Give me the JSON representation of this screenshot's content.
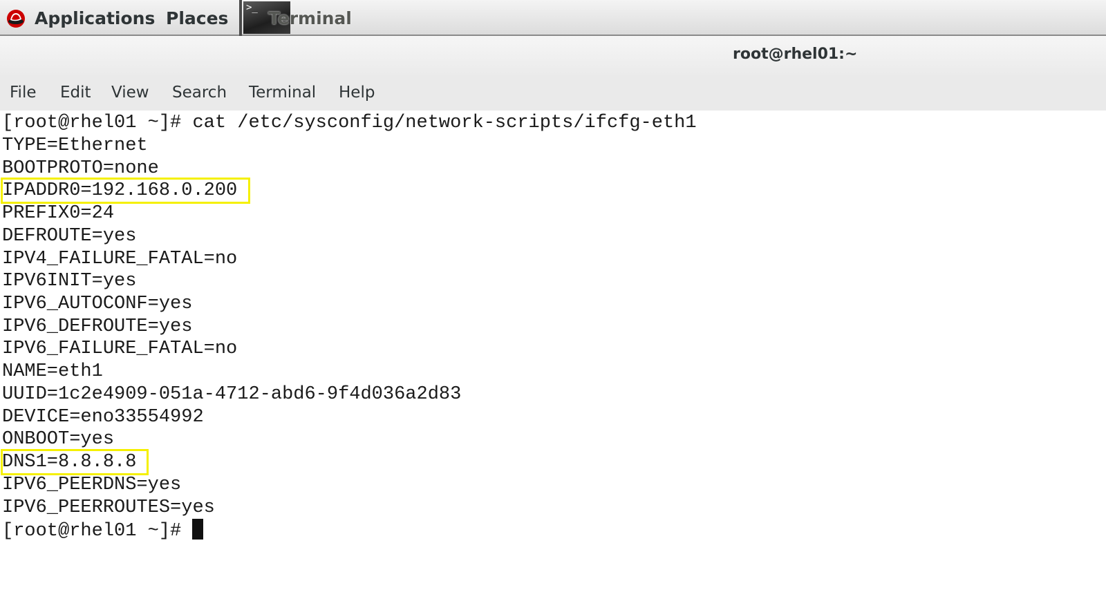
{
  "top_panel": {
    "applications_label": "Applications",
    "places_label": "Places",
    "task_label": "Terminal",
    "task_icon_glyph": ">_",
    "applications_icon": "redhat-logo-icon"
  },
  "window": {
    "title": "root@rhel01:~"
  },
  "menu": {
    "items": [
      "File",
      "Edit",
      "View",
      "Search",
      "Terminal",
      "Help"
    ]
  },
  "terminal": {
    "lines": [
      "[root@rhel01 ~]# cat /etc/sysconfig/network-scripts/ifcfg-eth1",
      "TYPE=Ethernet",
      "BOOTPROTO=none",
      "IPADDR0=192.168.0.200",
      "PREFIX0=24",
      "DEFROUTE=yes",
      "IPV4_FAILURE_FATAL=no",
      "IPV6INIT=yes",
      "IPV6_AUTOCONF=yes",
      "IPV6_DEFROUTE=yes",
      "IPV6_FAILURE_FATAL=no",
      "NAME=eth1",
      "UUID=1c2e4909-051a-4712-abd6-9f4d036a2d83",
      "DEVICE=eno33554992",
      "ONBOOT=yes",
      "DNS1=8.8.8.8",
      "IPV6_PEERDNS=yes",
      "IPV6_PEERROUTES=yes"
    ],
    "prompt": "[root@rhel01 ~]# ",
    "highlight_color": "#f5f000"
  }
}
